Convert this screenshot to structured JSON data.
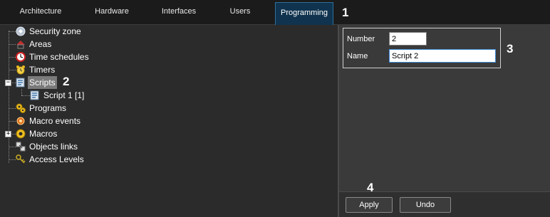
{
  "tabs": [
    {
      "label": "Architecture",
      "active": false
    },
    {
      "label": "Hardware",
      "active": false
    },
    {
      "label": "Interfaces",
      "active": false
    },
    {
      "label": "Users",
      "active": false
    },
    {
      "label": "Programming",
      "active": true
    }
  ],
  "callouts": [
    "1",
    "2",
    "3",
    "4"
  ],
  "tree": {
    "items": [
      {
        "label": "Security zone",
        "icon": "security-zone-icon"
      },
      {
        "label": "Areas",
        "icon": "areas-icon"
      },
      {
        "label": "Time schedules",
        "icon": "clock-icon"
      },
      {
        "label": "Timers",
        "icon": "alarm-clock-icon"
      },
      {
        "label": "Scripts",
        "icon": "script-icon",
        "selected": true,
        "expanded": true
      },
      {
        "label": "Script 1 [1]",
        "icon": "script-icon"
      },
      {
        "label": "Programs",
        "icon": "gears-icon"
      },
      {
        "label": "Macro events",
        "icon": "macro-event-icon"
      },
      {
        "label": "Macros",
        "icon": "gear-icon",
        "collapsed": true
      },
      {
        "label": "Objects links",
        "icon": "links-icon"
      },
      {
        "label": "Access Levels",
        "icon": "access-levels-icon"
      }
    ]
  },
  "properties": {
    "number_label": "Number",
    "number_value": "2",
    "name_label": "Name",
    "name_value": "Script 2"
  },
  "buttons": {
    "apply": "Apply",
    "undo": "Undo"
  },
  "colors": {
    "active_tab_bg": "#10344f",
    "active_tab_border": "#2e6f9c",
    "selection_bg": "#7a7a7a"
  }
}
